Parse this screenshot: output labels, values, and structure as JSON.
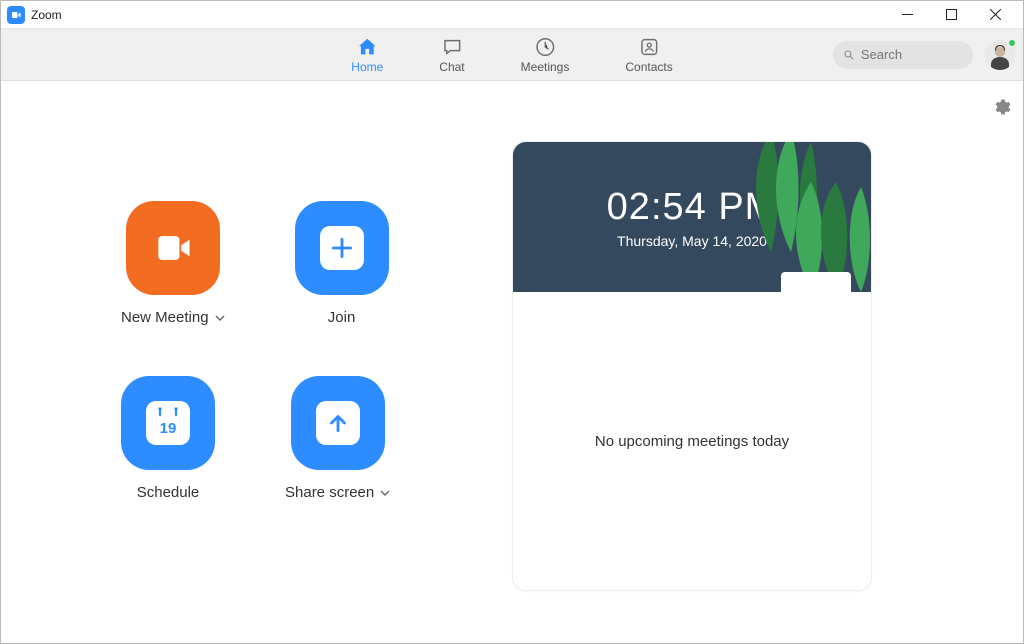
{
  "window": {
    "title": "Zoom"
  },
  "nav": {
    "home": "Home",
    "chat": "Chat",
    "meetings": "Meetings",
    "contacts": "Contacts"
  },
  "search": {
    "placeholder": "Search"
  },
  "actions": {
    "new_meeting": "New Meeting",
    "join": "Join",
    "schedule": "Schedule",
    "schedule_day": "19",
    "share_screen": "Share screen"
  },
  "info": {
    "time": "02:54 PM",
    "date": "Thursday, May 14, 2020",
    "no_meetings": "No upcoming meetings today"
  }
}
